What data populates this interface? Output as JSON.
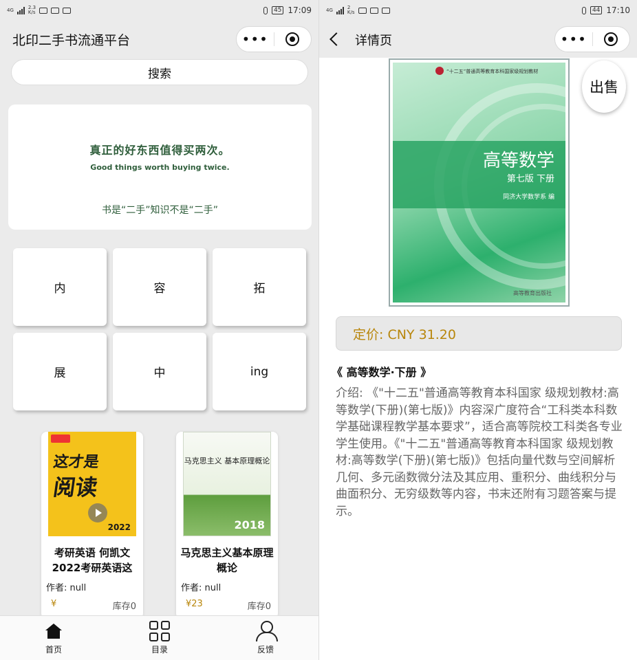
{
  "left": {
    "status": {
      "net": "4G",
      "speed": "2.3",
      "speed_unit": "K/s",
      "battery": "45",
      "time": "17:09"
    },
    "nav_title": "北印二手书流通平台",
    "search_label": "搜索",
    "banner": {
      "slogan": "真正的好东西值得买两次。",
      "slogan_en": "Good things worth buying twice.",
      "sub": "书是“二手”知识不是“二手”"
    },
    "grid": [
      "内",
      "容",
      "拓",
      "展",
      "中",
      "ing"
    ],
    "books": [
      {
        "cover_line1": "这才是",
        "cover_line2": "阅读",
        "cover_year": "2022",
        "title": "考研英语 何凯文 2022考研英语这",
        "author": "作者: null",
        "price": "¥",
        "stock": "库存0"
      },
      {
        "cover_text": "马克思主义 基本原理概论",
        "cover_year": "2018",
        "title": "马克思主义基本原理概论",
        "author": "作者: null",
        "price": "¥23",
        "stock": "库存0"
      }
    ],
    "tabs": [
      {
        "label": "首页",
        "icon": "home-icon"
      },
      {
        "label": "目录",
        "icon": "grid-icon"
      },
      {
        "label": "反馈",
        "icon": "user-icon"
      }
    ]
  },
  "right": {
    "status": {
      "net": "4G",
      "speed": "2",
      "speed_unit": "K/s",
      "battery": "44",
      "time": "17:10"
    },
    "nav_title": "详情页",
    "cover": {
      "series": "“十二五”普通高等教育本科国家级规划教材",
      "title": "高等数学",
      "edition": "第七版  下册",
      "author": "同济大学数学系  编",
      "publisher": "高等教育出版社"
    },
    "sell_label": "出售",
    "price_label": "定价: CNY 31.20",
    "book_title": "《 高等数学·下册 》",
    "description": "介绍: 《\"十二五\"普通高等教育本科国家 级规划教材:高等数学(下册)(第七版)》内容深广度符合“工科类本科数学基础课程教学基本要求”，适合高等院校工科类各专业学生使用。《\"十二五\"普通高等教育本科国家 级规划教材:高等数学(下册)(第七版)》包括向量代数与空间解析几何、多元函数微分法及其应用、重积分、曲线积分与曲面积分、无穷级数等内容，书末还附有习题答案与提示。"
  },
  "colors": {
    "accent_green": "#2f5e3b",
    "price_gold": "#b8860b",
    "cover_yellow": "#f4c21b",
    "cover_green": "#2db06d"
  }
}
